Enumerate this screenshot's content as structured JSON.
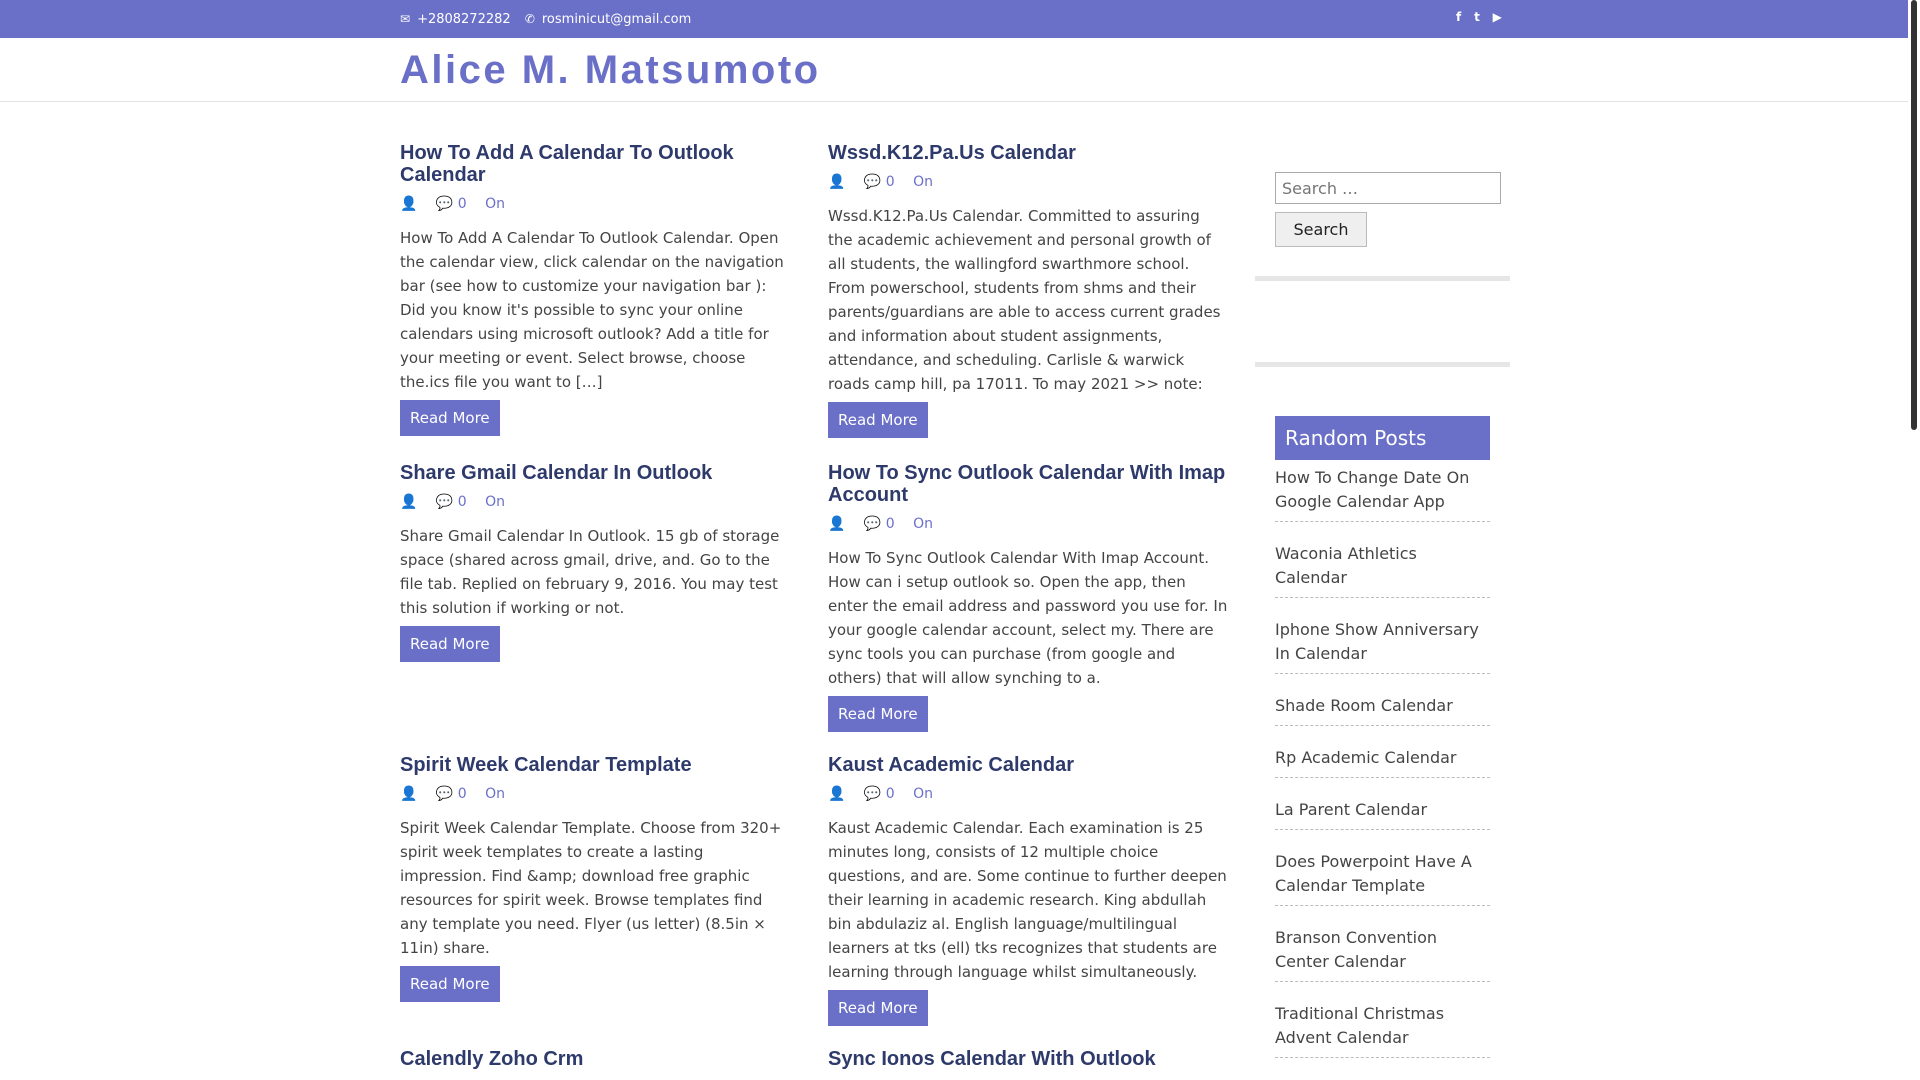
{
  "topbar": {
    "phone_icon": "envelope-icon",
    "phone": "+2808272282",
    "email_icon": "phone-icon",
    "email": "rosminicut@gmail.com",
    "social": [
      {
        "icon": "facebook-icon",
        "glyph": "f"
      },
      {
        "icon": "twitter-icon",
        "glyph": "t"
      },
      {
        "icon": "youtube-icon",
        "glyph": "▶"
      }
    ]
  },
  "site": {
    "title": "Alice M. Matsumoto"
  },
  "posts": [
    {
      "title": "How To Add A Calendar To Outlook Calendar",
      "comments": "0",
      "on": "On",
      "excerpt": "How To Add A Calendar To Outlook Calendar. Open the calendar view, click calendar on the navigation bar (see how to customize your navigation bar ): Did you know it's possible to sync your online calendars using microsoft outlook? Add a title for your meeting or event. Select browse, choose the.ics file you want to […]",
      "read_more": "Read More"
    },
    {
      "title": "Wssd.K12.Pa.Us Calendar",
      "comments": "0",
      "on": "On",
      "excerpt": "Wssd.K12.Pa.Us Calendar. Committed to assuring the academic achievement and personal growth of all students, the wallingford swarthmore school. From powerschool, students from shms and their parents/guardians are able to access current grades and information about student assignments, attendance, and scheduling. Carlisle & warwick roads camp hill, pa 17011. To may 2021 >> note:",
      "read_more": "Read More"
    },
    {
      "title": "Share Gmail Calendar In Outlook",
      "comments": "0",
      "on": "On",
      "excerpt": "Share Gmail Calendar In Outlook. 15 gb of storage space (shared across gmail, drive, and. Go to the file tab. Replied on february 9, 2016. You may test this solution if working or not.",
      "read_more": "Read More"
    },
    {
      "title": "How To Sync Outlook Calendar With Imap Account",
      "comments": "0",
      "on": "On",
      "excerpt": "How To Sync Outlook Calendar With Imap Account. How can i setup outlook so. Open the app, then enter the email address and password you use for. In your google calendar account, select my. There are sync tools you can purchase (from google and others) that will allow synching to a.",
      "read_more": "Read More"
    },
    {
      "title": "Spirit Week Calendar Template",
      "comments": "0",
      "on": "On",
      "excerpt": "Spirit Week Calendar Template. Choose from 320+ spirit week templates to create a lasting impression. Find &amp; download free graphic resources for spirit week. Browse templates find any template you need. Flyer (us letter) (8.5in × 11in) share.",
      "read_more": "Read More"
    },
    {
      "title": "Kaust Academic Calendar",
      "comments": "0",
      "on": "On",
      "excerpt": "Kaust Academic Calendar. Each examination is 25 minutes long, consists of 12 multiple choice questions, and are. Some continue to further deepen their learning in academic research. King abdullah bin abdulaziz al. English language/multilingual learners at tks (ell) tks recognizes that students are learning through language whilst simultaneously.",
      "read_more": "Read More"
    },
    {
      "title": "Calendly Zoho Crm"
    },
    {
      "title": "Sync Ionos Calendar With Outlook"
    }
  ],
  "sidebar": {
    "search_placeholder": "Search …",
    "search_button": "Search",
    "random_posts_title": "Random Posts",
    "random_posts": [
      "How To Change Date On Google Calendar App",
      "Waconia Athletics Calendar",
      "Iphone Show Anniversary In Calendar",
      "Shade Room Calendar",
      "Rp Academic Calendar",
      "La Parent Calendar",
      "Does Powerpoint Have A Calendar Template",
      "Branson Convention Center Calendar",
      "Traditional Christmas Advent Calendar"
    ]
  }
}
